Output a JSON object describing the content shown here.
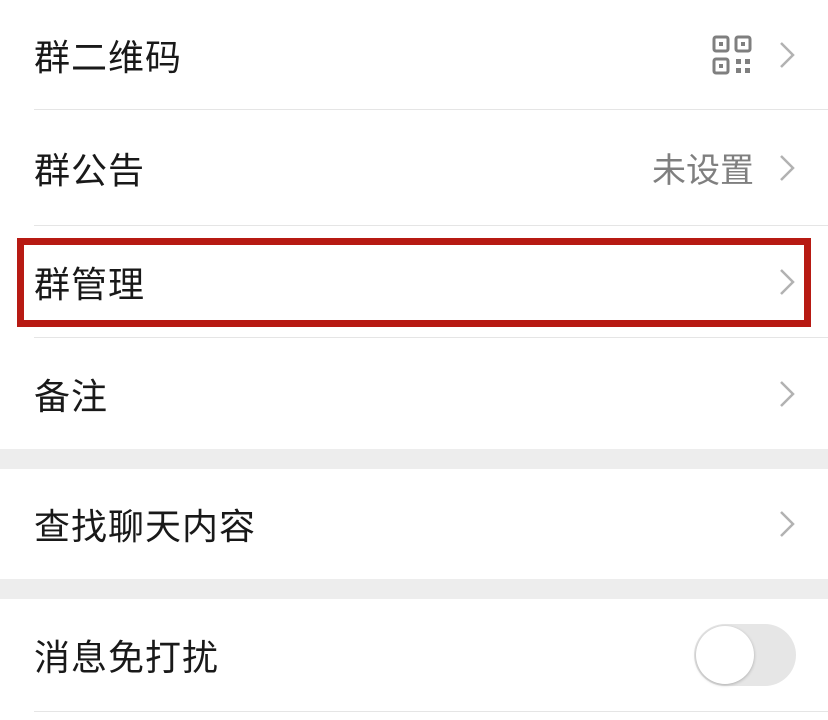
{
  "settings": {
    "group_qr": {
      "label": "群二维码",
      "icon": "qr-code-icon"
    },
    "group_notice": {
      "label": "群公告",
      "value": "未设置"
    },
    "group_manage": {
      "label": "群管理"
    },
    "remark": {
      "label": "备注"
    },
    "search_chat": {
      "label": "查找聊天内容"
    },
    "mute": {
      "label": "消息免打扰",
      "enabled": false
    }
  },
  "colors": {
    "background": "#ededed",
    "card": "#ffffff",
    "label": "#191919",
    "secondary": "#7f7f7f",
    "highlight": "#b71a13",
    "toggle_off": "#e6e6e6"
  }
}
